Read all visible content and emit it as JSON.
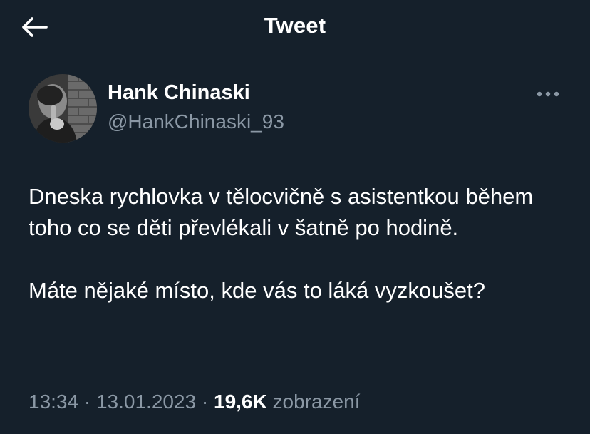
{
  "header": {
    "title": "Tweet",
    "back_icon": "arrow-left-icon"
  },
  "author": {
    "name": "Hank Chinaski",
    "handle": "@HankChinaski_93",
    "avatar": "avatar-photo"
  },
  "more_icon": "more-horizontal-icon",
  "tweet": {
    "paragraphs": [
      "Dneska rychlovka v tělocvičně s asistentkou během toho co se děti převlékali v šatně po hodině.",
      "Máte nějaké místo, kde vás to láká vyzkoušet?"
    ]
  },
  "meta": {
    "time": "13:34",
    "separator": "·",
    "date": "13.01.2023",
    "views_count": "19,6K",
    "views_label": "zobrazení"
  },
  "colors": {
    "background": "#15202b",
    "text_primary": "#ffffff",
    "text_secondary": "#8b98a5"
  }
}
